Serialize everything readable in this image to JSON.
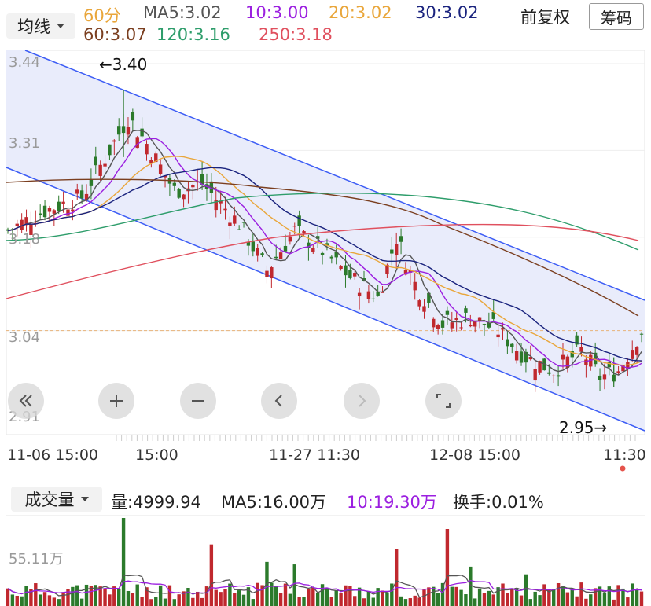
{
  "header": {
    "ma_selector_label": "均线",
    "period": "60分",
    "ma_items": [
      {
        "label": "MA5:3.02",
        "color": "#555555"
      },
      {
        "label": "10:3.00",
        "color": "#9b1fe0"
      },
      {
        "label": "20:3.02",
        "color": "#e9a63a"
      },
      {
        "label": "30:3.02",
        "color": "#1a237e"
      },
      {
        "label": "60:3.07",
        "color": "#7b3f20"
      },
      {
        "label": "120:3.16",
        "color": "#2e9d6b"
      },
      {
        "label": "250:3.18",
        "color": "#e0505e"
      }
    ],
    "adjust_label": "前复权",
    "chips_button": "筹码"
  },
  "price_chart": {
    "y_ticks": [
      "3.44",
      "3.31",
      "3.18",
      "3.04",
      "2.91"
    ],
    "x_ticks": [
      "11-06 15:00",
      "15:00",
      "11-27 11:30",
      "12-08 15:00",
      "11:30"
    ],
    "high_annotation": "←3.40",
    "low_annotation": "2.95→",
    "last_price": 3.04
  },
  "nav_buttons": [
    {
      "name": "scroll-left-fast-icon",
      "glyph": "double-chevron-left"
    },
    {
      "name": "zoom-in-icon",
      "glyph": "plus"
    },
    {
      "name": "zoom-out-icon",
      "glyph": "minus"
    },
    {
      "name": "scroll-left-icon",
      "glyph": "chevron-left"
    },
    {
      "name": "scroll-right-icon",
      "glyph": "chevron-right"
    },
    {
      "name": "fullscreen-icon",
      "glyph": "corners"
    }
  ],
  "volume": {
    "selector_label": "成交量",
    "amount_label": "量:4999.94",
    "ma5_label": "MA5:16.00万",
    "ma10_label": "10:19.30万",
    "turnover_label": "换手:0.01%",
    "y_tick": "55.11万"
  },
  "colors": {
    "up": "#c0282e",
    "down": "#2b7a2b",
    "channel": "#3d5df5",
    "channel_fill": "#e9ecfb"
  }
}
